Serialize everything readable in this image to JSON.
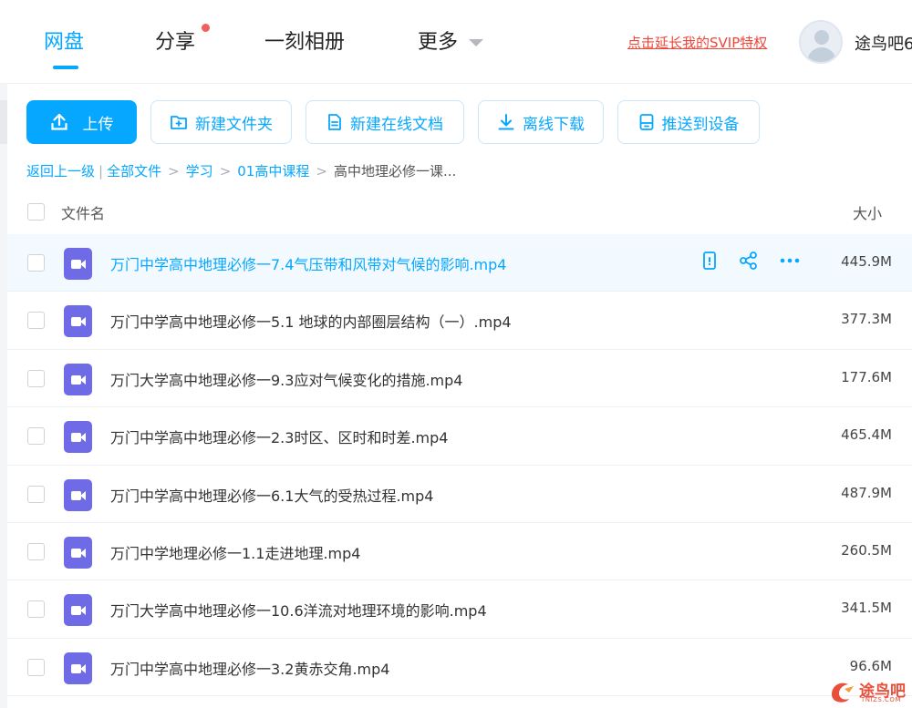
{
  "nav": {
    "tabs": [
      {
        "label": "网盘",
        "active": true
      },
      {
        "label": "分享",
        "badge_dot": true
      },
      {
        "label": "一刻相册"
      },
      {
        "label": "更多"
      }
    ],
    "svip_link": "点击延长我的SVIP特权",
    "username": "途鸟吧6"
  },
  "toolbar": {
    "upload": "上传",
    "new_folder": "新建文件夹",
    "new_doc": "新建在线文档",
    "offline_download": "离线下载",
    "push_device": "推送到设备"
  },
  "breadcrumb": {
    "back": "返回上一级",
    "items": [
      "全部文件",
      "学习",
      "01高中课程"
    ],
    "current": "高中地理必修一课..."
  },
  "table": {
    "col_name": "文件名",
    "col_size": "大小",
    "rows": [
      {
        "name": "万门中学高中地理必修一7.4气压带和风带对气候的影响.mp4",
        "size": "445.9M"
      },
      {
        "name": "万门中学高中地理必修一5.1 地球的内部圈层结构（一）.mp4",
        "size": "377.3M"
      },
      {
        "name": "万门大学高中地理必修一9.3应对气候变化的措施.mp4",
        "size": "177.6M"
      },
      {
        "name": "万门中学高中地理必修一2.3时区、区时和时差.mp4",
        "size": "465.4M"
      },
      {
        "name": "万门中学高中地理必修一6.1大气的受热过程.mp4",
        "size": "487.9M"
      },
      {
        "name": "万门中学地理必修一1.1走进地理.mp4",
        "size": "260.5M"
      },
      {
        "name": "万门大学高中地理必修一10.6洋流对地理环境的影响.mp4",
        "size": "341.5M"
      },
      {
        "name": "万门中学高中地理必修一3.2黄赤交角.mp4",
        "size": "96.6M"
      }
    ]
  },
  "watermark": {
    "text": "途鸟吧",
    "sub": "TNIZS.COM"
  },
  "colors": {
    "accent": "#06a7ff",
    "svip": "#f0463a",
    "video_icon": "#6f6ae6"
  },
  "icons": [
    "upload-icon",
    "folder-plus-icon",
    "document-icon",
    "download-icon",
    "device-icon",
    "phone-icon",
    "share-icon",
    "more-icon",
    "video-icon"
  ]
}
